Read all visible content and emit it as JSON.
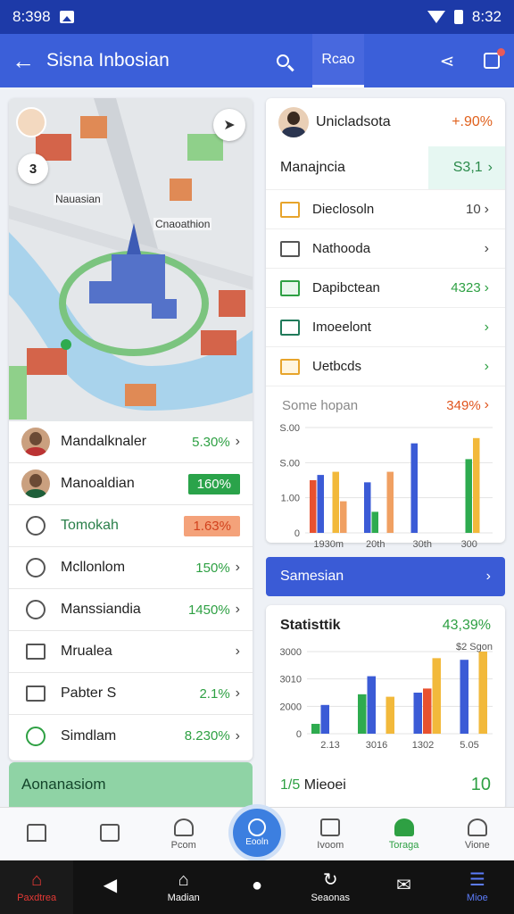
{
  "status_bar": {
    "time": "8:398",
    "right_time": "8:32"
  },
  "app_bar": {
    "title": "Sisna Inbosian",
    "tab_label": "Rcao"
  },
  "map": {
    "label_1": "Nauasian",
    "label_2": "Cnaoathion",
    "level": "3"
  },
  "left_list": [
    {
      "label": "Mandalknaler",
      "value": "5.30%"
    },
    {
      "label": "Manoaldian",
      "value": "160%"
    },
    {
      "label": "Tomokah",
      "value": "1.63%"
    },
    {
      "label": "Mcllonlom",
      "value": "150%"
    },
    {
      "label": "Manssiandia",
      "value": "1450%"
    },
    {
      "label": "Mrualea",
      "value": ""
    },
    {
      "label": "Pabter S",
      "value": "2.1%"
    },
    {
      "label": "Simdlam",
      "value": "8.230%"
    }
  ],
  "left_footer": "Aonanasiom",
  "right_card": {
    "profile_name": "Unicladsota",
    "profile_pct": "+.90%",
    "manage_label": "Manajncia",
    "manage_value": "S3,1",
    "menu": [
      {
        "label": "Dieclosoln",
        "value": "10"
      },
      {
        "label": "Nathooda",
        "value": ""
      },
      {
        "label": "Dapibctean",
        "value": "4323"
      },
      {
        "label": "Imoeelont",
        "value": ""
      },
      {
        "label": "Uetbcds",
        "value": ""
      }
    ],
    "chart_label": "Some hopan",
    "chart_value": "349%"
  },
  "blue_bar_label": "Samesian",
  "stats_card": {
    "title": "Statisttik",
    "value": "43,39%",
    "footer_prefix": "1/5",
    "footer_text": "Mieoei",
    "footer_right": "10"
  },
  "bottom_nav": [
    {
      "label": ""
    },
    {
      "label": ""
    },
    {
      "label": "Pcom"
    },
    {
      "label": "Eooln"
    },
    {
      "label": "Ivoom"
    },
    {
      "label": "Toraga"
    },
    {
      "label": "Vione"
    }
  ],
  "sys_nav": [
    "Paxdtrea",
    "",
    "Madian",
    "",
    "Seaonas",
    "",
    "Mioe"
  ],
  "chart_data": [
    {
      "type": "bar",
      "title": "Some hopan",
      "categories": [
        "1930m",
        "20th",
        "30th",
        "300"
      ],
      "y_ticks": [
        "S.00",
        "S.00",
        "1.00",
        "0"
      ],
      "series": [
        {
          "name": "",
          "color": "#e8512f",
          "values": [
            50,
            0,
            0,
            0
          ]
        },
        {
          "name": "",
          "color": "#3b5bd6",
          "values": [
            55,
            48,
            85,
            0
          ]
        },
        {
          "name": "",
          "color": "#2eab4f",
          "values": [
            0,
            20,
            0,
            70
          ]
        },
        {
          "name": "",
          "color": "#f2b93b",
          "values": [
            58,
            0,
            0,
            90
          ]
        },
        {
          "name": "",
          "color": "#f0a062",
          "values": [
            30,
            58,
            0,
            0
          ]
        }
      ],
      "ylim": [
        0,
        100
      ]
    },
    {
      "type": "bar",
      "title": "Statisttik",
      "categories": [
        "2.13",
        "3016",
        "1302",
        "5.05"
      ],
      "y_ticks": [
        "3000",
        "3010",
        "2000",
        "0"
      ],
      "annotation": "$2 Sgon",
      "series": [
        {
          "name": "",
          "color": "#2eab4f",
          "values": [
            12,
            48,
            0,
            0
          ]
        },
        {
          "name": "",
          "color": "#3b5bd6",
          "values": [
            35,
            70,
            50,
            90
          ]
        },
        {
          "name": "",
          "color": "#e8512f",
          "values": [
            0,
            0,
            55,
            0
          ]
        },
        {
          "name": "",
          "color": "#f2b93b",
          "values": [
            0,
            45,
            92,
            100
          ]
        }
      ],
      "ylim": [
        0,
        100
      ]
    }
  ]
}
